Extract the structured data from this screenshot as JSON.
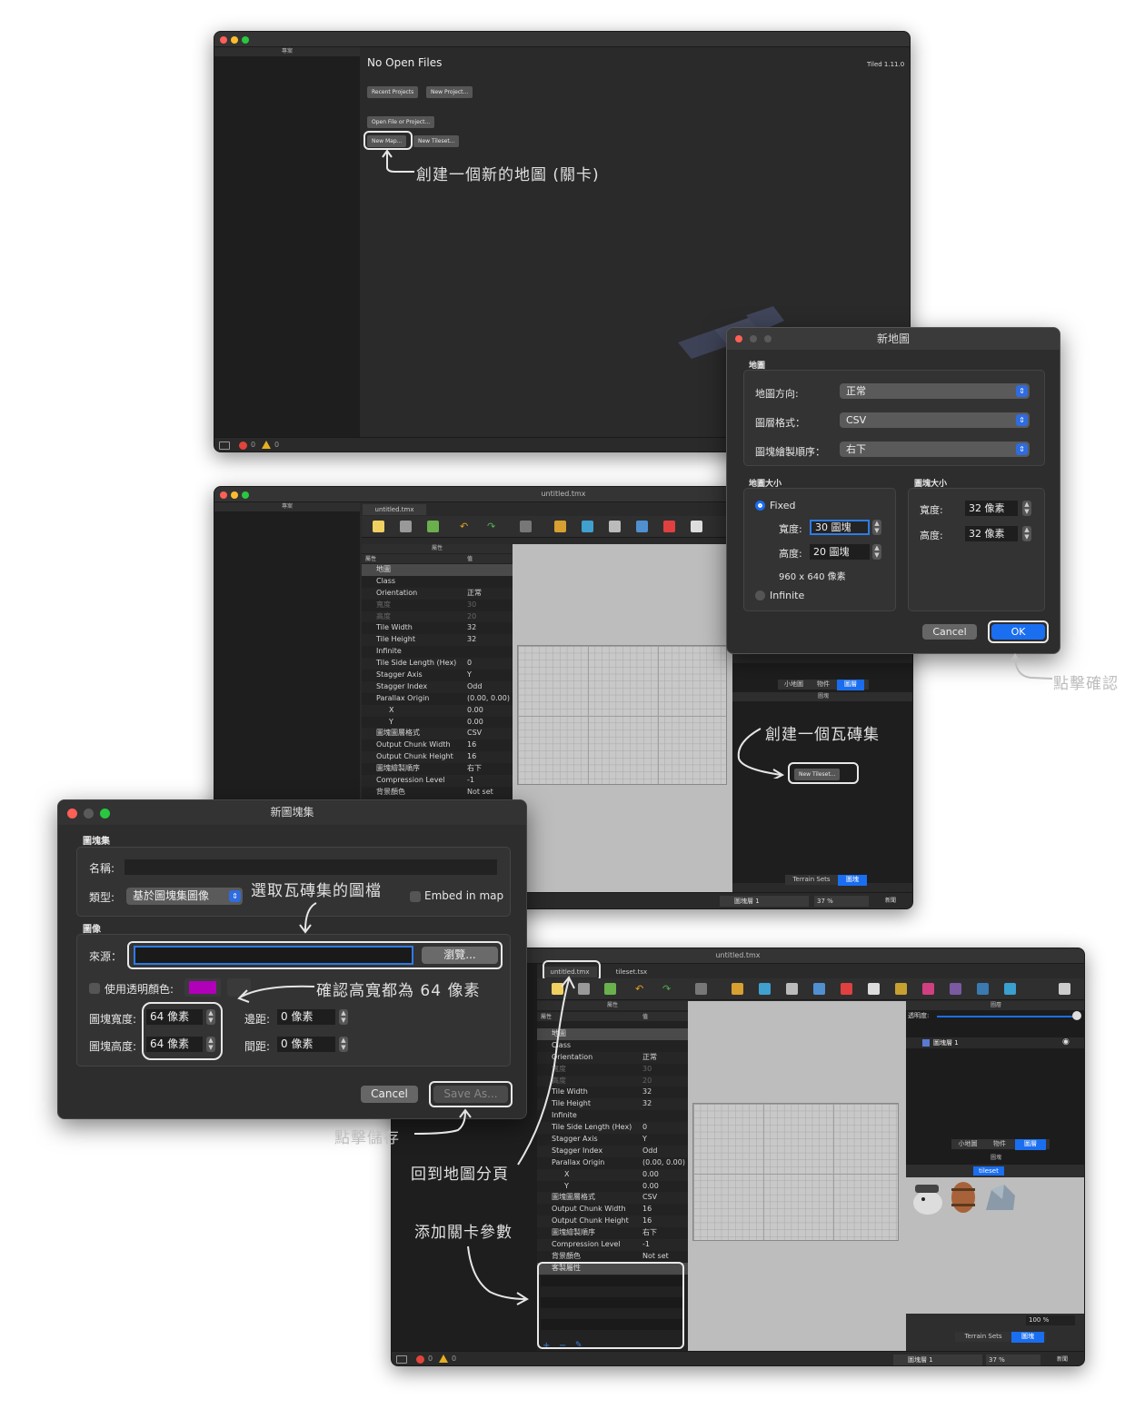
{
  "colors": {
    "accent": "#1a6ef0",
    "panel": "#2b2b2b",
    "dock": "#1e1e1e",
    "canvas": "#bdbdbd",
    "transparent_swatch": "#b000b8"
  },
  "screen1": {
    "project_dock_title": "專案",
    "heading": "No Open Files",
    "version": "Tiled 1.11.0",
    "buttons": {
      "recent_projects": "Recent Projects",
      "new_project": "New Project...",
      "open_file": "Open File or Project...",
      "new_map": "New Map...",
      "new_tileset": "New Tileset..."
    },
    "status": {
      "errors": "0",
      "warnings": "0"
    }
  },
  "dialog_new_map": {
    "title": "新地圖",
    "section_map": "地圖",
    "orientation_label": "地圖方向:",
    "orientation_value": "正常",
    "layer_format_label": "圖層格式：",
    "layer_format_value": "CSV",
    "render_order_label": "圖塊繪製順序：",
    "render_order_value": "右下",
    "section_map_size": "地圖大小",
    "section_tile_size": "圖塊大小",
    "fixed_label": "Fixed",
    "width_label": "寬度:",
    "width_value": "30 圖塊",
    "height_label": "高度:",
    "height_value": "20 圖塊",
    "pixel_size": "960 x 640 像素",
    "infinite_label": "Infinite",
    "tile_width_label": "寬度:",
    "tile_width_value": "32 像素",
    "tile_height_label": "高度:",
    "tile_height_value": "32 像素",
    "cancel": "Cancel",
    "ok": "OK"
  },
  "screen2": {
    "window_title": "untitled.tmx",
    "project_dock_title": "專案",
    "tab": "untitled.tmx",
    "props_title": "屬性",
    "col_prop": "屬性",
    "col_value": "值",
    "tiles_dock_title": "圖塊",
    "mini_tabs": [
      "小地圖",
      "物件",
      "圖層"
    ],
    "new_tileset_button": "New Tileset...",
    "bottom_tabs": [
      "Terrain Sets",
      "圖塊"
    ],
    "status": {
      "layer": "圖塊層 1",
      "zoom": "37 %",
      "news": "新聞"
    }
  },
  "properties": [
    {
      "k": "地圖",
      "v": "",
      "type": "grp"
    },
    {
      "k": "Class",
      "v": ""
    },
    {
      "k": "Orientation",
      "v": "正常"
    },
    {
      "k": "寬度",
      "v": "30",
      "type": "dim"
    },
    {
      "k": "高度",
      "v": "20",
      "type": "dim"
    },
    {
      "k": "Tile Width",
      "v": "32"
    },
    {
      "k": "Tile Height",
      "v": "32"
    },
    {
      "k": "Infinite",
      "v": ""
    },
    {
      "k": "Tile Side Length (Hex)",
      "v": "0"
    },
    {
      "k": "Stagger Axis",
      "v": "Y"
    },
    {
      "k": "Stagger Index",
      "v": "Odd"
    },
    {
      "k": "Parallax Origin",
      "v": "(0.00, 0.00)"
    },
    {
      "k": "X",
      "v": "0.00"
    },
    {
      "k": "Y",
      "v": "0.00"
    },
    {
      "k": "圖塊圖層格式",
      "v": "CSV"
    },
    {
      "k": "Output Chunk Width",
      "v": "16"
    },
    {
      "k": "Output Chunk Height",
      "v": "16"
    },
    {
      "k": "圖塊繪製順序",
      "v": "右下"
    },
    {
      "k": "Compression Level",
      "v": "-1"
    },
    {
      "k": "背景顏色",
      "v": "Not set"
    }
  ],
  "custom_props_label": "客製屬性",
  "dialog_new_tileset": {
    "title": "新圖塊集",
    "section_tileset": "圖塊集",
    "name_label": "名稱:",
    "name_value": "",
    "type_label": "類型:",
    "type_value": "基於圖塊集圖像",
    "embed_label": "Embed in map",
    "section_image": "圖像",
    "source_label": "來源：",
    "source_value": "",
    "browse": "瀏覽...",
    "transparent_label": "使用透明顏色:",
    "tile_width_label": "圖塊寬度:",
    "tile_width_value": "64 像素",
    "tile_height_label": "圖塊高度:",
    "tile_height_value": "64 像素",
    "margin_label": "邊距:",
    "margin_value": "0 像素",
    "spacing_label": "間距:",
    "spacing_value": "0 像素",
    "cancel": "Cancel",
    "save": "Save As..."
  },
  "screen3": {
    "window_title": "untitled.tmx",
    "tabs": [
      "untitled.tmx",
      "tileset.tsx"
    ],
    "props_title": "屬性",
    "layers_title": "圖層",
    "opacity_label": "透明度:",
    "layer_name": "圖塊層 1",
    "mini_tabs": [
      "小地圖",
      "物件",
      "圖層"
    ],
    "tiles_title": "圖塊",
    "tileset_tab": "tileset",
    "tileset_zoom": "100 %",
    "bottom_tabs": [
      "Terrain Sets",
      "圖塊"
    ],
    "status": {
      "layer": "圖塊層 1",
      "zoom": "37 %",
      "news": "新聞",
      "errors": "0",
      "warnings": "0"
    }
  },
  "annotations": {
    "create_map": "創建一個新的地圖 (關卡)",
    "click_confirm": "點擊確認",
    "create_tileset": "創建一個瓦磚集",
    "choose_image": "選取瓦磚集的圖檔",
    "confirm_size": "確認高寬都為 64 像素",
    "click_save": "點擊儲存",
    "back_to_map": "回到地圖分頁",
    "add_params": "添加關卡參數"
  }
}
